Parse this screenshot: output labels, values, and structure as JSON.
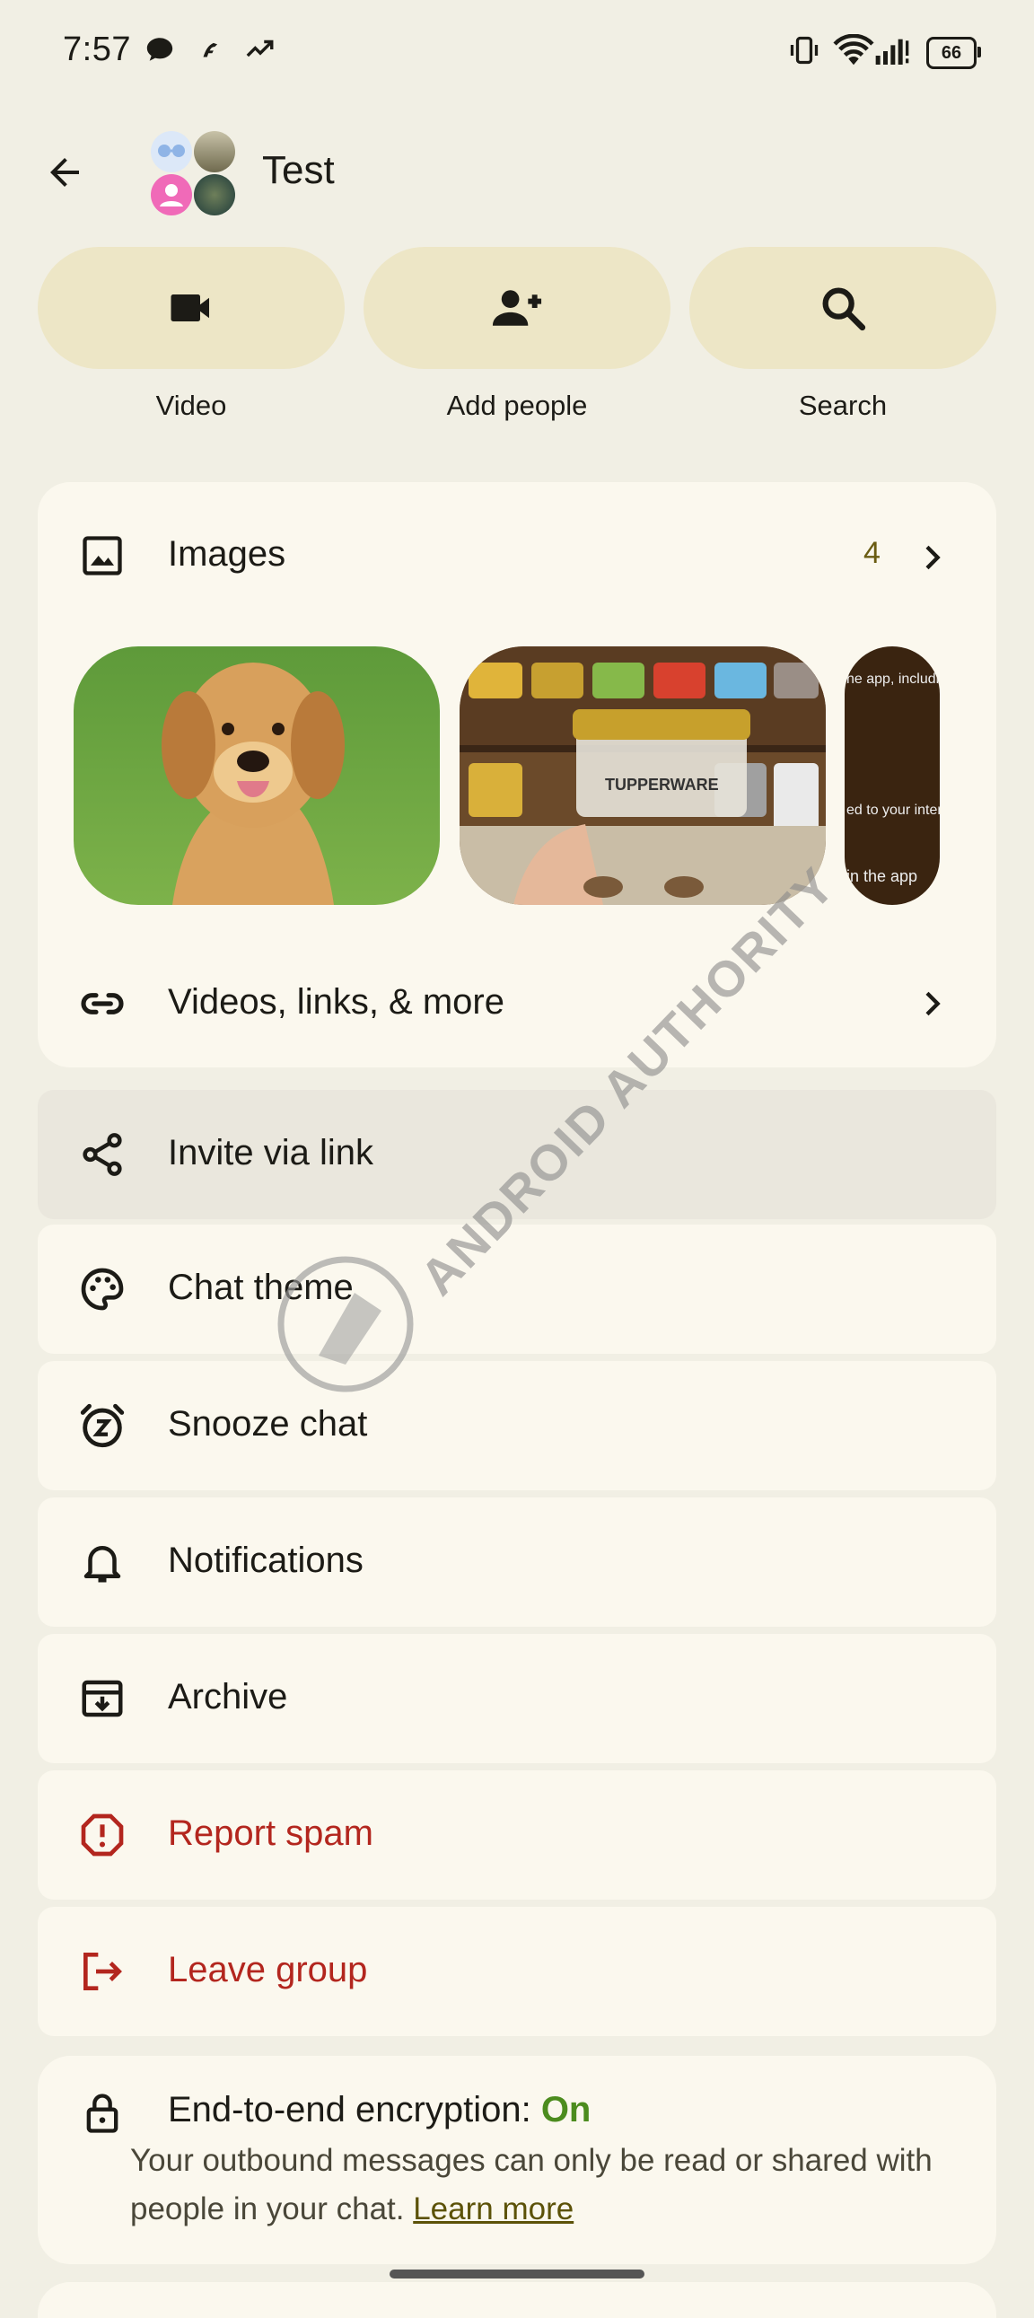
{
  "status_bar": {
    "time": "7:57",
    "battery": "66"
  },
  "header": {
    "title": "Test"
  },
  "actions": [
    {
      "label": "Video",
      "icon": "video-icon"
    },
    {
      "label": "Add people",
      "icon": "add-person-icon"
    },
    {
      "label": "Search",
      "icon": "search-icon"
    }
  ],
  "images_section": {
    "label": "Images",
    "count": "4"
  },
  "thumbnails": {
    "third_lines": [
      "he app, including",
      "ed to your interest",
      "in the app"
    ],
    "tupperware_label": "TUPPERWARE"
  },
  "videos_links": {
    "label": "Videos, links, & more"
  },
  "menu": {
    "invite": "Invite via link",
    "theme": "Chat theme",
    "snooze": "Snooze chat",
    "notifications": "Notifications",
    "archive": "Archive",
    "report": "Report spam",
    "leave": "Leave group"
  },
  "encryption": {
    "label": "End-to-end encryption:",
    "status": "On",
    "description": "Your outbound messages can only be read or shared with people in your chat.",
    "learn_more": "Learn more"
  },
  "watermark": {
    "text": "ANDROID AUTHORITY"
  },
  "colors": {
    "background": "#F1EFE4",
    "card": "#FBF8EE",
    "action": "#EDE6C6",
    "danger": "#B3261E",
    "on": "#4C8C1E"
  }
}
